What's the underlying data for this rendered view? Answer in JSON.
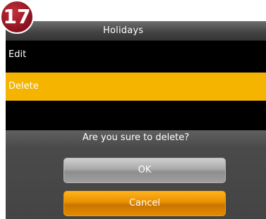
{
  "step_badge": "17",
  "window": {
    "title": "Holidays"
  },
  "menu": {
    "items": [
      {
        "label": "Edit"
      },
      {
        "label": "Delete"
      }
    ]
  },
  "dialog": {
    "message": "Are you sure to delete?",
    "ok_label": "OK",
    "cancel_label": "Cancel"
  },
  "colors": {
    "highlight": "#f4b400",
    "cancel_button": "#e88f00",
    "ok_button": "#a8a8a8",
    "badge": "#9b1a28"
  }
}
